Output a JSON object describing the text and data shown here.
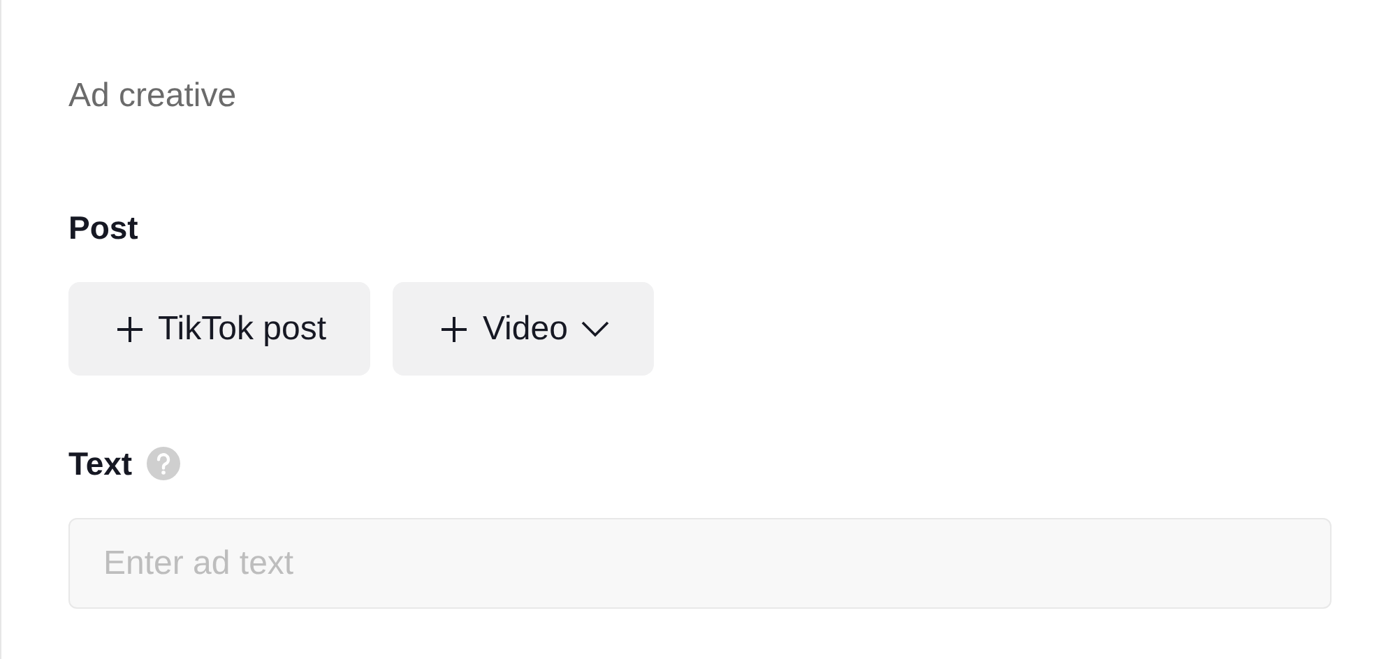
{
  "section_title": "Ad creative",
  "post": {
    "label": "Post",
    "buttons": [
      {
        "label": "TikTok post",
        "kind": "plain"
      },
      {
        "label": "Video",
        "kind": "dropdown"
      }
    ]
  },
  "text": {
    "label": "Text",
    "input": {
      "placeholder": "Enter ad text"
    }
  }
}
